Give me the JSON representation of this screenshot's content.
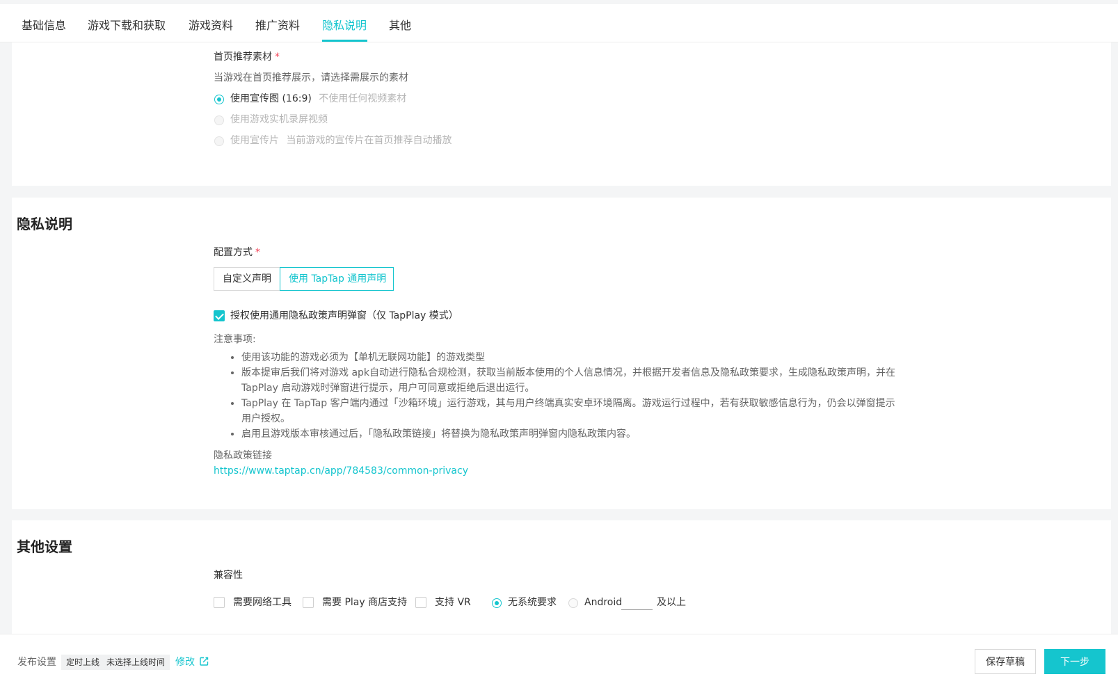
{
  "tabs": [
    {
      "label": "基础信息",
      "active": false
    },
    {
      "label": "游戏下载和获取",
      "active": false
    },
    {
      "label": "游戏资料",
      "active": false
    },
    {
      "label": "推广资料",
      "active": false
    },
    {
      "label": "隐私说明",
      "active": true
    },
    {
      "label": "其他",
      "active": false
    }
  ],
  "homepage_material": {
    "label": "首页推荐素材",
    "required_mark": "*",
    "hint": "当游戏在首页推荐展示，请选择需展示的素材",
    "options": [
      {
        "label": "使用宣传图 (16:9)",
        "note": "不使用任何视频素材",
        "selected": true,
        "disabled": false
      },
      {
        "label": "使用游戏实机录屏视频",
        "note": "",
        "selected": false,
        "disabled": true
      },
      {
        "label": "使用宣传片",
        "note": "当前游戏的宣传片在首页推荐自动播放",
        "selected": false,
        "disabled": true
      }
    ]
  },
  "privacy": {
    "title": "隐私说明",
    "config_label": "配置方式",
    "required_mark": "*",
    "segments": [
      {
        "label": "自定义声明",
        "selected": false
      },
      {
        "label": "使用 TapTap 通用声明",
        "selected": true
      }
    ],
    "authorize_checkbox": {
      "label": "授权使用通用隐私政策声明弹窗（仅 TapPlay 模式）",
      "checked": true
    },
    "notes_title": "注意事项:",
    "notes": [
      "使用该功能的游戏必须为【单机无联网功能】的游戏类型",
      "版本提审后我们将对游戏 apk自动进行隐私合规检测，获取当前版本使用的个人信息情况，并根据开发者信息及隐私政策要求，生成隐私政策声明，并在 TapPlay 启动游戏时弹窗进行提示，用户可同意或拒绝后退出运行。",
      "TapPlay 在 TapTap 客户端内通过「沙箱环境」运行游戏，其与用户终端真实安卓环境隔离。游戏运行过程中，若有获取敏感信息行为，仍会以弹窗提示用户授权。",
      "启用且游戏版本审核通过后，「隐私政策链接」将替换为隐私政策声明弹窗内隐私政策内容。"
    ],
    "policy_link_label": "隐私政策链接",
    "policy_link_url": "https://www.taptap.cn/app/784583/common-privacy"
  },
  "other_settings": {
    "title": "其他设置",
    "compat_label": "兼容性",
    "checkboxes": [
      {
        "label": "需要网络工具",
        "checked": false
      },
      {
        "label": "需要 Play 商店支持",
        "checked": false
      },
      {
        "label": "支持 VR",
        "checked": false
      }
    ],
    "radios": [
      {
        "label": "无系统要求",
        "selected": true
      },
      {
        "label": "Android",
        "selected": false
      }
    ],
    "android_suffix": "及以上",
    "android_version_value": ""
  },
  "footer": {
    "publish_label": "发布设置",
    "badge_text_1": "定时上线",
    "badge_text_2": "未选择上线时间",
    "modify_label": "修改",
    "save_draft_label": "保存草稿",
    "next_label": "下一步"
  },
  "colors": {
    "accent": "#15c5ce",
    "required": "#f5475b"
  }
}
